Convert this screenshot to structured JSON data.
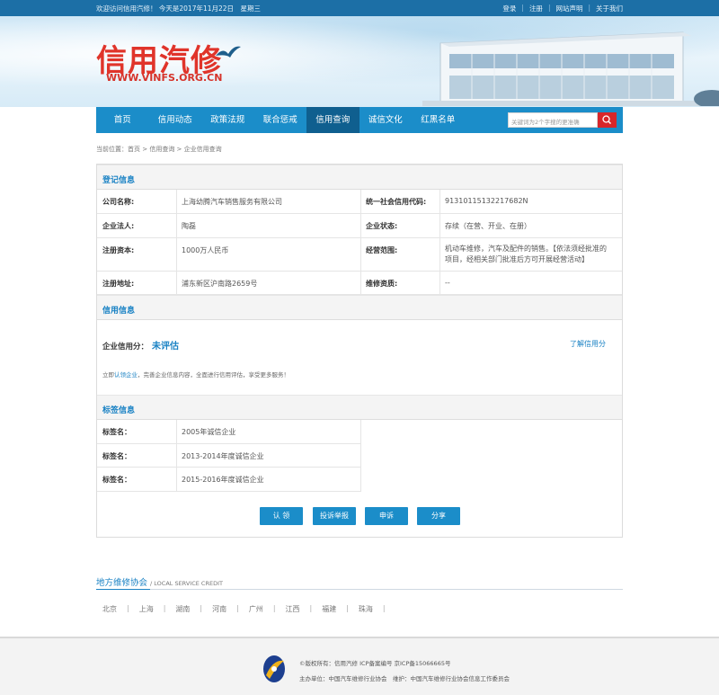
{
  "topbar": {
    "welcome": "欢迎访问信用汽修！ 今天是2017年11月22日　星期三",
    "links": [
      "登录",
      "注册",
      "网站声明",
      "关于我们"
    ]
  },
  "banner": {
    "logo_text": "信用汽修",
    "logo_url": "WWW.VINFS.ORG.CN"
  },
  "nav": {
    "items": [
      "首页",
      "信用动态",
      "政策法规",
      "联合惩戒",
      "信用查询",
      "诚信文化",
      "红黑名单"
    ],
    "active_index": 4,
    "search_placeholder": "关键词为2个字搜的更准确"
  },
  "breadcrumb": "当前位置：首页 > 信用查询 > 企业信用查询",
  "registration": {
    "title": "登记信息",
    "rows": [
      {
        "l1": "公司名称:",
        "v1": "上海幼腾汽车销售服务有限公司",
        "l2": "统一社会信用代码:",
        "v2": "91310115132217682N"
      },
      {
        "l1": "企业法人:",
        "v1": "陶磊",
        "l2": "企业状态:",
        "v2": "存续（在营、开业、在册）"
      },
      {
        "l1": "注册资本:",
        "v1": "1000万人民币",
        "l2": "经营范围:",
        "v2a": "机动车维修，汽车及配件的销售。【依法须经批准的",
        "v2b": "项目，经相关部门批准后方可开展经营活动】"
      },
      {
        "l1": "注册地址:",
        "v1": "浦东新区沪南路2659号",
        "l2": "维修资质:",
        "v2": "--"
      }
    ]
  },
  "credit": {
    "title": "信用信息",
    "score_label": "企业信用分：",
    "score_value": "未评估",
    "more_link": "了解信用分",
    "tip_prefix": "立即",
    "tip_link": "认领企业",
    "tip_suffix": "，完善企业信息内容，全面进行信用评估，享受更多服务！"
  },
  "tags": {
    "title": "标签信息",
    "rows": [
      {
        "label": "标签名：",
        "value": "2005年诚信企业"
      },
      {
        "label": "标签名：",
        "value": "2013-2014年度诚信企业"
      },
      {
        "label": "标签名：",
        "value": "2015-2016年度诚信企业"
      }
    ]
  },
  "actions": [
    "认 领",
    "投诉举报",
    "申诉",
    "分享"
  ],
  "local": {
    "title": "地方维修协会",
    "subtitle": "/ LOCAL SERVICE CREDIT",
    "cities": [
      "北京",
      "上海",
      "湖南",
      "河南",
      "广州",
      "江西",
      "福建",
      "珠海"
    ]
  },
  "footer": {
    "line1": "©版权所有：信用汽修  ICP备案编号 京ICP备15066665号",
    "line2": "主办单位：中国汽车维修行业协会　维护：中国汽车维修行业协会信息工作委员会"
  },
  "colors": {
    "primary": "#1b8dc9",
    "nav_active": "#0f5f8f",
    "logo_red": "#e0342a",
    "link": "#1a82c4"
  }
}
